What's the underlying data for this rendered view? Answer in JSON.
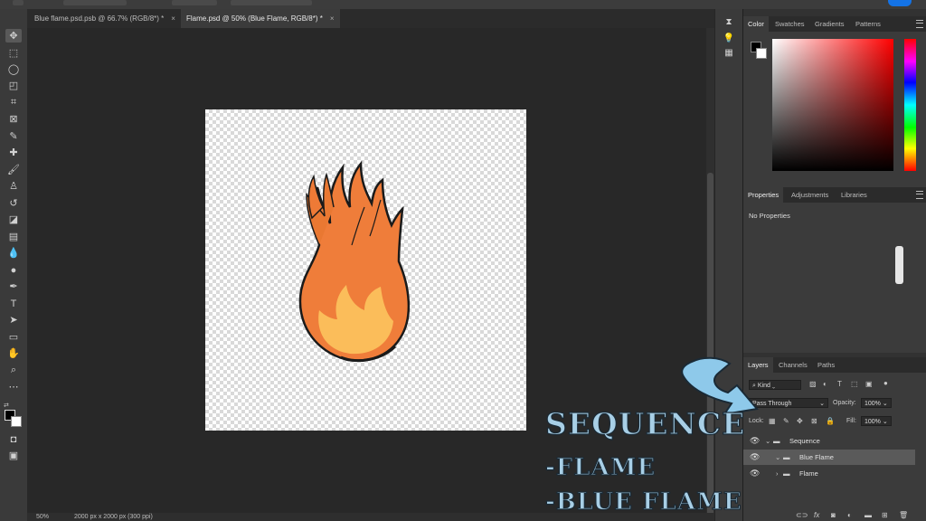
{
  "tabs": [
    {
      "label": "Blue flame.psd.psb @ 66.7% (RGB/8*) *",
      "close": "×"
    },
    {
      "label": "Flame.psd @ 50% (Blue Flame, RGB/8*) *",
      "close": "×"
    }
  ],
  "status": {
    "zoom": "50%",
    "doc_info": "2000 px x 2000 px (300 ppi)"
  },
  "color_panel": {
    "tabs": [
      "Color",
      "Swatches",
      "Gradients",
      "Patterns"
    ]
  },
  "properties_panel": {
    "tabs": [
      "Properties",
      "Adjustments",
      "Libraries"
    ],
    "empty_text": "No Properties"
  },
  "layers_panel": {
    "tabs": [
      "Layers",
      "Channels",
      "Paths"
    ],
    "filter_kind": "Kind",
    "blend_mode": "Pass Through",
    "opacity_label": "Opacity:",
    "opacity_value": "100%",
    "lock_label": "Lock:",
    "fill_label": "Fill:",
    "fill_value": "100%",
    "layers": [
      {
        "name": "Sequence",
        "type": "group",
        "expanded": true,
        "indent": 0
      },
      {
        "name": "Blue Flame",
        "type": "group",
        "expanded": true,
        "indent": 1,
        "selected": true
      },
      {
        "name": "Flame",
        "type": "group",
        "expanded": false,
        "indent": 1
      }
    ],
    "footer_icons": [
      "link-icon",
      "fx-icon",
      "mask-icon",
      "adjustment-icon",
      "new-group-icon",
      "new-layer-icon",
      "trash-icon"
    ]
  },
  "overlay": {
    "line1": "SEQUENCE",
    "line2": "-FLAME",
    "line3": "-BLUE FLAME"
  },
  "colors": {
    "accent": "#1473e6",
    "foreground": "#000000",
    "background": "#ffffff",
    "overlay_text": "#a8cfe6"
  }
}
